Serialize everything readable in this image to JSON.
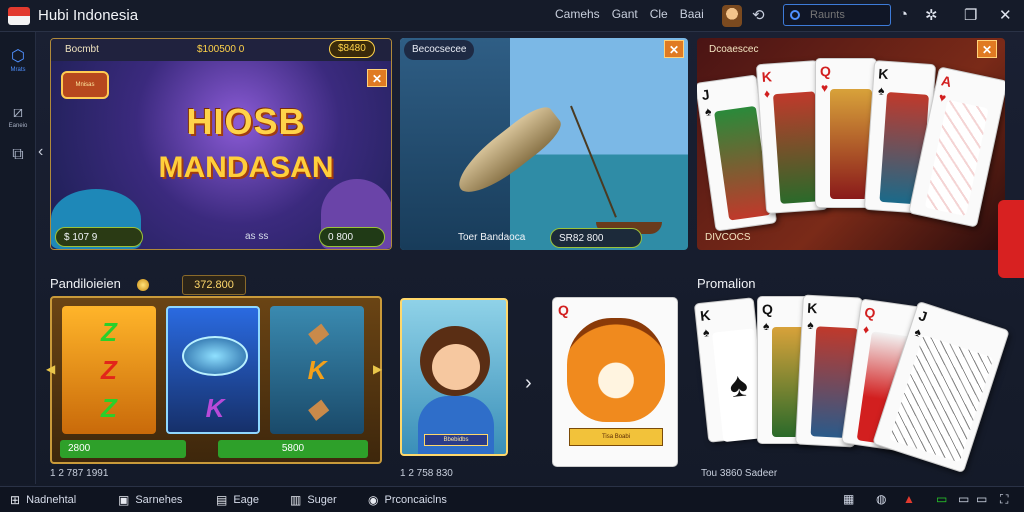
{
  "app": {
    "title": "Hubi Indonesia"
  },
  "nav": [
    "Camehs",
    "Gant",
    "Cle",
    "Baai"
  ],
  "search": {
    "placeholder": "Raunts"
  },
  "sidebar": [
    {
      "label": "Mrats"
    },
    {
      "label": "Eaneio"
    },
    {
      "label": ""
    }
  ],
  "cards": {
    "slot_game": {
      "header_left": "Bocmbt",
      "header_amount": "$100500 0",
      "header_right": "$8480",
      "badge": "Mnisas",
      "title_line1": "HIOSB",
      "title_line2": "MANDASAN",
      "footer_left": "$ 107 9",
      "footer_right": "0 800",
      "footer_mid": "as ss"
    },
    "fishing_game": {
      "header": "Becocsecee",
      "footer_label": "Toer Bandaoca",
      "footer_amount": "SR82 800"
    },
    "card_game": {
      "header": "Dcoaescec",
      "footer": "DIVCOCS"
    }
  },
  "section_left": {
    "title": "Pandiloieien",
    "amount": "372.800",
    "slot_bar_left": "2800",
    "slot_bar_right": "5800",
    "caption": "1 2 787 1991"
  },
  "section_mid": {
    "girl_label": "Bbebidbs",
    "tiger_label": "Tisa Boabi",
    "caption": "1 2 758 830"
  },
  "section_right": {
    "title": "Promalion",
    "caption": "Tou 3860 Sadeer"
  },
  "taskbar": {
    "items": [
      "Nadnehtal",
      "Sarnehes",
      "Eage",
      "Suger",
      "Prconcaiclns"
    ]
  },
  "colors": {
    "accent": "#4f90ff",
    "gold": "#ffd34a",
    "red": "#d82121",
    "bg": "#141a28"
  }
}
